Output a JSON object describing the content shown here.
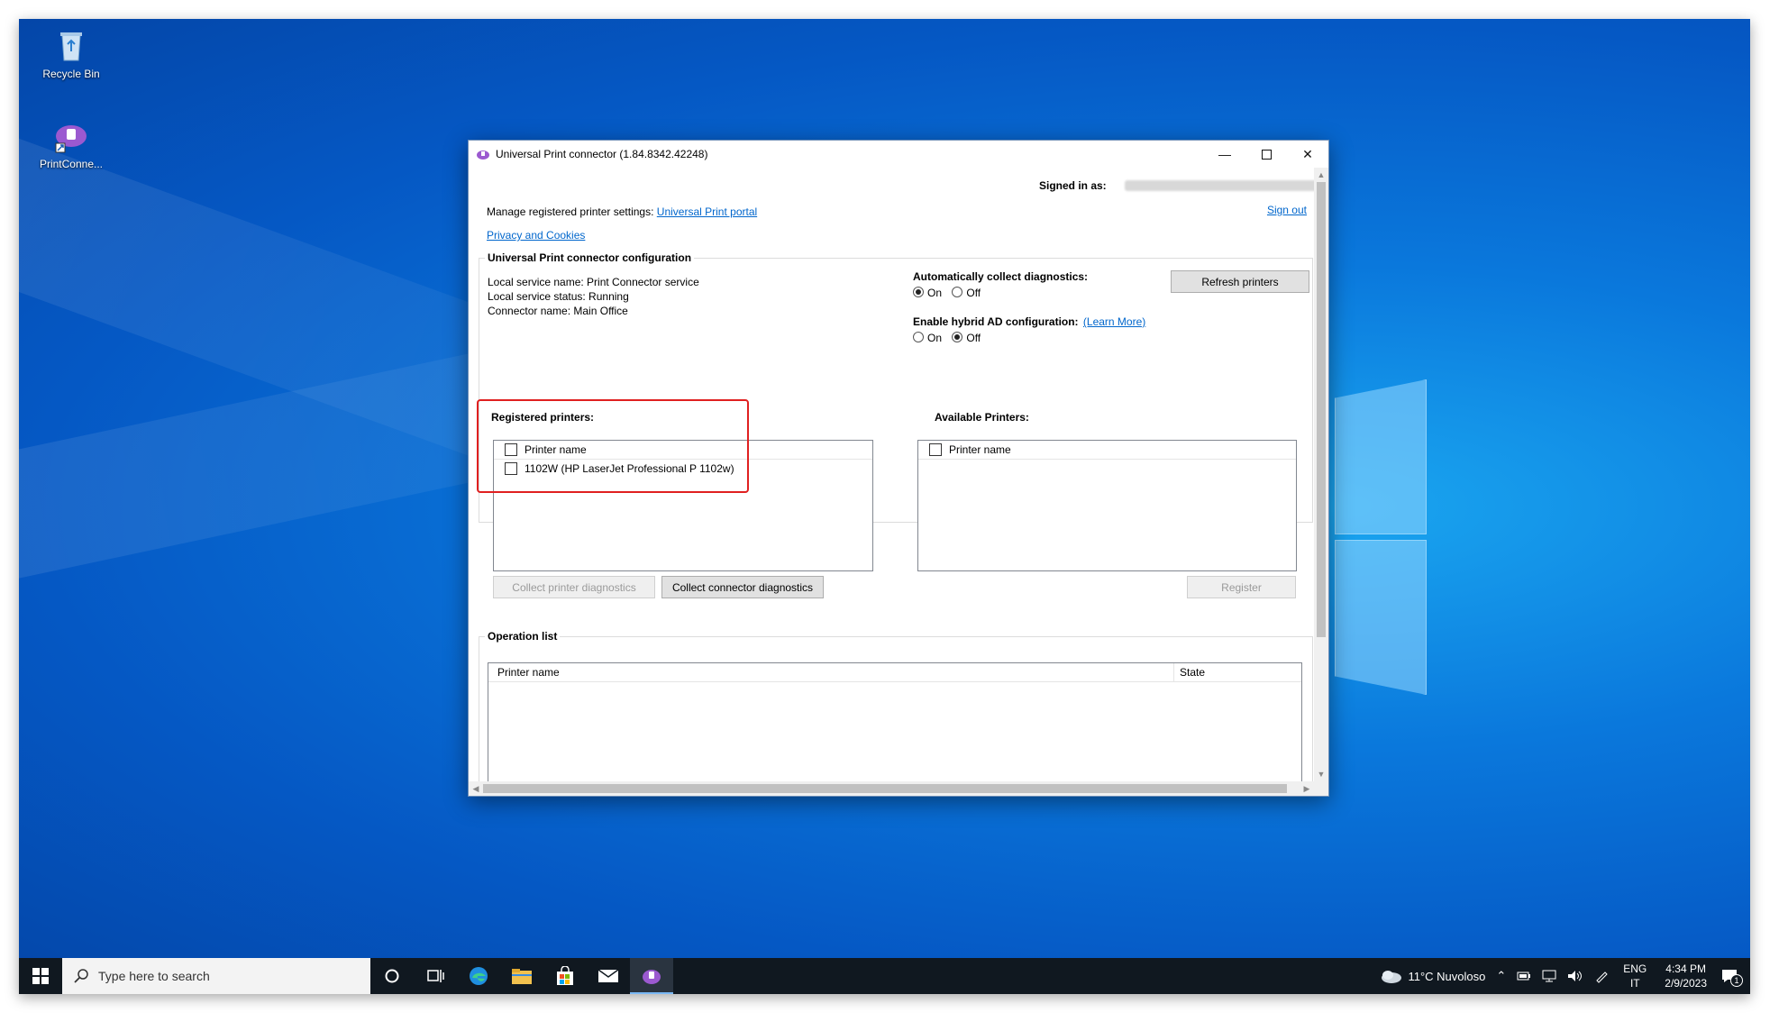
{
  "desktop": {
    "icons": [
      {
        "label": "Recycle Bin"
      },
      {
        "label": "PrintConne..."
      }
    ]
  },
  "window": {
    "title": "Universal Print connector (1.84.8342.42248)",
    "signed_in_label": "Signed in as:",
    "sign_out": "Sign out",
    "manage_text": "Manage registered printer settings:",
    "portal_link": "Universal Print portal",
    "privacy_link": "Privacy and Cookies",
    "config_heading": "Universal Print connector configuration",
    "service_name": "Local service name: Print Connector service",
    "service_status": "Local service status: Running",
    "connector_name": "Connector name: Main Office",
    "auto_diag_label": "Automatically collect diagnostics:",
    "auto_diag_on": "On",
    "auto_diag_off": "Off",
    "hybrid_label": "Enable hybrid AD configuration:",
    "learn_more": "(Learn More)",
    "hybrid_on": "On",
    "hybrid_off": "Off",
    "refresh_button": "Refresh printers",
    "registered_heading": "Registered printers:",
    "available_heading": "Available Printers:",
    "col_printer_name": "Printer name",
    "registered_printers": [
      "1102W (HP LaserJet Professional P 1102w)"
    ],
    "collect_printer_diag": "Collect printer diagnostics",
    "collect_connector_diag": "Collect connector diagnostics",
    "register_button": "Register",
    "operation_heading": "Operation list",
    "op_col_name": "Printer name",
    "op_col_state": "State"
  },
  "taskbar": {
    "search_placeholder": "Type here to search",
    "weather": "11°C  Nuvoloso",
    "lang_top": "ENG",
    "lang_bottom": "IT",
    "time": "4:34 PM",
    "date": "2/9/2023",
    "notification_count": "1"
  },
  "colors": {
    "accent": "#0066cc",
    "highlight": "#e02020",
    "desktop": "#0a78dc"
  }
}
